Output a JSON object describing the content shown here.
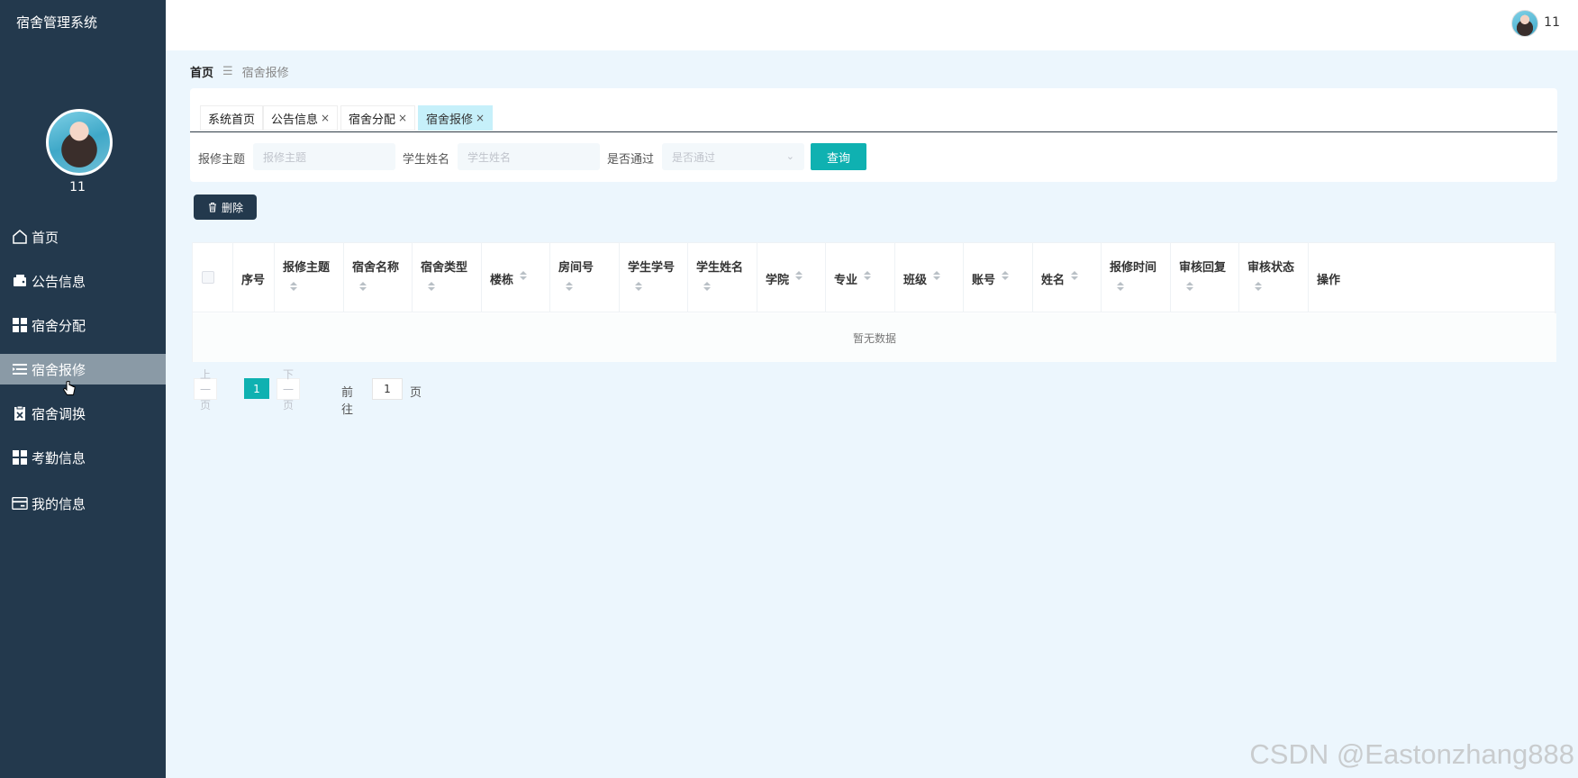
{
  "app": {
    "title": "宿舍管理系统"
  },
  "profile": {
    "name": "11"
  },
  "sidebar": {
    "items": [
      {
        "label": "首页",
        "icon": "home-icon"
      },
      {
        "label": "公告信息",
        "icon": "wallet-icon"
      },
      {
        "label": "宿舍分配",
        "icon": "grid-icon"
      },
      {
        "label": "宿舍报修",
        "icon": "list-icon",
        "active": true
      },
      {
        "label": "宿舍调换",
        "icon": "clipboard-icon"
      },
      {
        "label": "考勤信息",
        "icon": "grid-icon"
      },
      {
        "label": "我的信息",
        "icon": "card-icon"
      }
    ]
  },
  "header": {
    "user": "11"
  },
  "breadcrumb": {
    "home": "首页",
    "separator": "☰",
    "current": "宿舍报修"
  },
  "tabs": [
    {
      "label": "系统首页",
      "closable": false
    },
    {
      "label": "公告信息",
      "closable": true
    },
    {
      "label": "宿舍分配",
      "closable": true
    },
    {
      "label": "宿舍报修",
      "closable": true,
      "active": true
    }
  ],
  "tab_close_glyph": "×",
  "search": {
    "topic_label": "报修主题",
    "topic_placeholder": "报修主题",
    "student_label": "学生姓名",
    "student_placeholder": "学生姓名",
    "passed_label": "是否通过",
    "passed_placeholder": "是否通过",
    "query_button": "查询"
  },
  "actions": {
    "delete_button": "删除"
  },
  "table": {
    "columns": [
      {
        "label": "序号",
        "sortable": false
      },
      {
        "label": "报修主题",
        "sortable": true
      },
      {
        "label": "宿舍名称",
        "sortable": true
      },
      {
        "label": "宿舍类型",
        "sortable": true
      },
      {
        "label": "楼栋",
        "sortable": true
      },
      {
        "label": "房间号",
        "sortable": true
      },
      {
        "label": "学生学号",
        "sortable": true
      },
      {
        "label": "学生姓名",
        "sortable": true
      },
      {
        "label": "学院",
        "sortable": true
      },
      {
        "label": "专业",
        "sortable": true
      },
      {
        "label": "班级",
        "sortable": true
      },
      {
        "label": "账号",
        "sortable": true
      },
      {
        "label": "姓名",
        "sortable": true
      },
      {
        "label": "报修时间",
        "sortable": true
      },
      {
        "label": "审核回复",
        "sortable": true
      },
      {
        "label": "审核状态",
        "sortable": true
      },
      {
        "label": "操作",
        "sortable": false
      }
    ],
    "empty_text": "暂无数据"
  },
  "pagination": {
    "prev": "上一页",
    "current_page": "1",
    "next": "下一页",
    "goto_label": "前往",
    "goto_value": "1",
    "page_suffix": "页"
  },
  "watermark": "CSDN @Eastonzhang888",
  "colors": {
    "sidebar": "#23394d",
    "accent": "#0fb1b1",
    "background": "#ecf6fd",
    "active_tab": "#c6f0fa"
  }
}
